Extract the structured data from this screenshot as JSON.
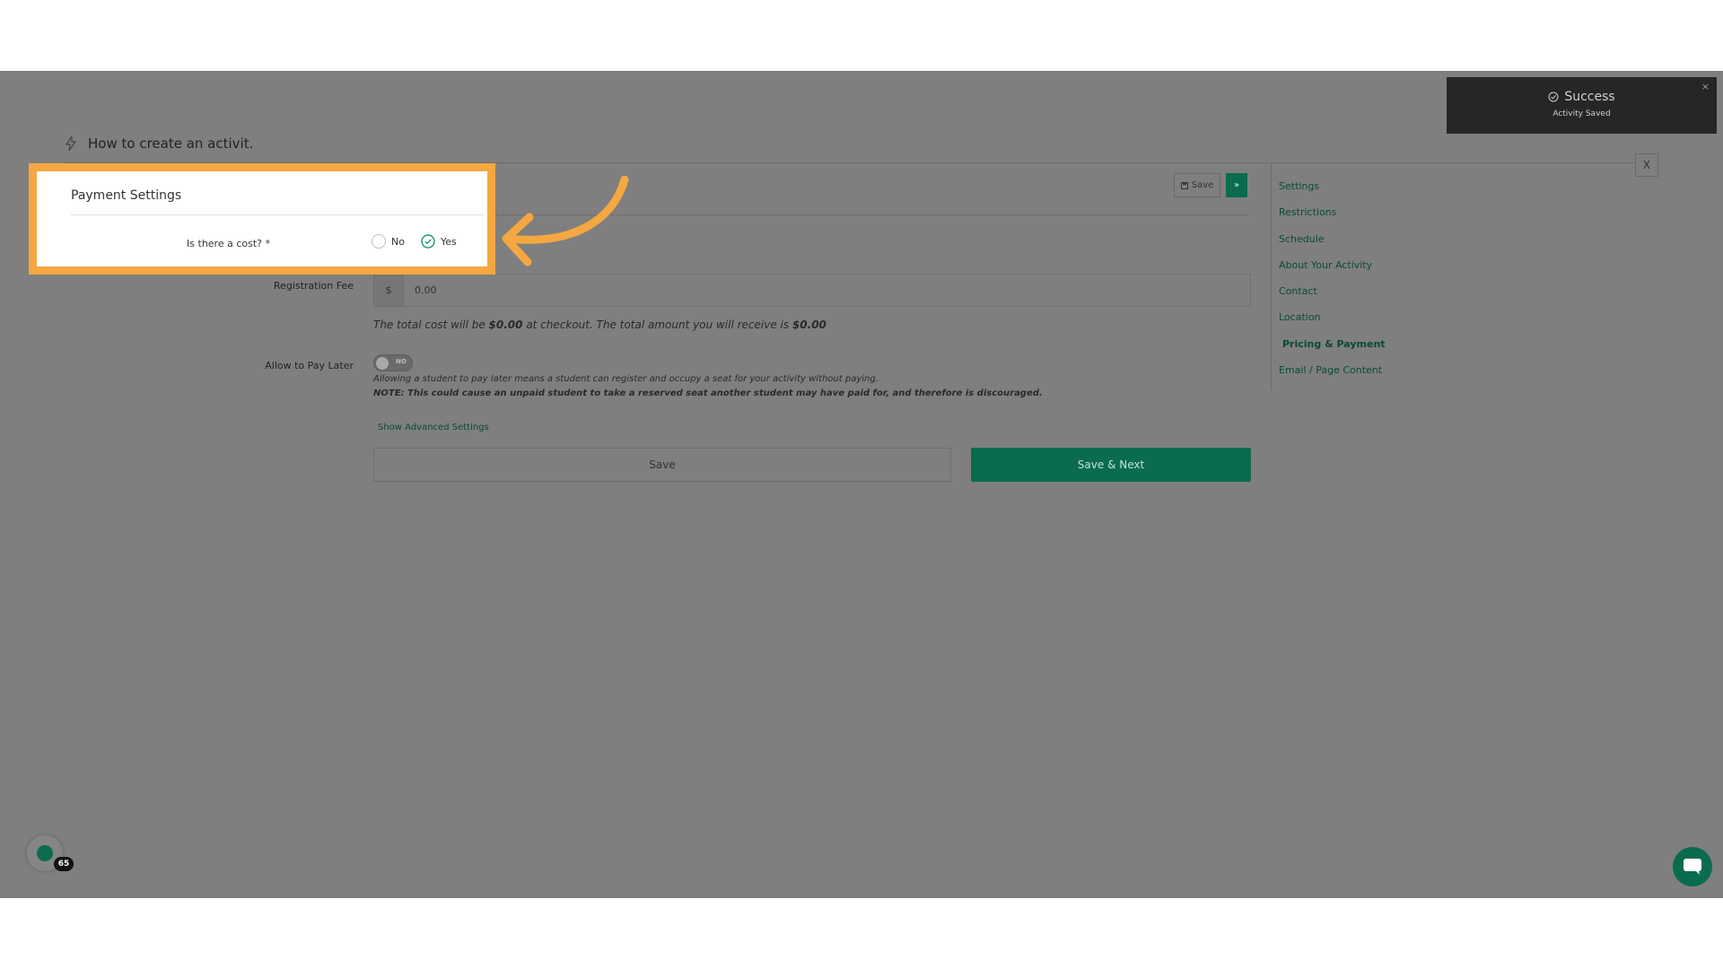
{
  "page": {
    "title": "How to create an activit."
  },
  "toast": {
    "title": "Success",
    "message": "Activity Saved",
    "close": "×"
  },
  "dialog": {
    "close": "X"
  },
  "toolbar": {
    "save_label": "Save",
    "next_label": "»"
  },
  "nav": {
    "items": [
      {
        "label": "Settings"
      },
      {
        "label": "Restrictions"
      },
      {
        "label": "Schedule"
      },
      {
        "label": "About Your Activity"
      },
      {
        "label": "Contact"
      },
      {
        "label": "Location"
      },
      {
        "label": "Pricing & Payment",
        "active": true
      },
      {
        "label": "Email / Page Content"
      }
    ]
  },
  "payment": {
    "heading": "Payment Settings",
    "cost_question": "Is there a cost? *",
    "option_no": "No",
    "option_yes": "Yes",
    "selected": "Yes"
  },
  "fee": {
    "label": "Registration Fee",
    "currency": "$",
    "value": "0.00",
    "note_prefix": "The total cost will be ",
    "note_total": "$0.00",
    "note_middle": " at checkout. The total amount you will receive is ",
    "note_receive": "$0.00"
  },
  "pay_later": {
    "label": "Allow to Pay Later",
    "toggle_text": "NO",
    "description": "Allowing a student to pay later means a student can register and occupy a seat for your activity without paying.",
    "warning": "NOTE: This could cause an unpaid student to take a reserved seat another student may have paid for, and therefore is discouraged."
  },
  "advanced": {
    "link": "Show Advanced Settings"
  },
  "actions": {
    "save": "Save",
    "save_next": "Save & Next"
  },
  "widget": {
    "badge": "65"
  },
  "colors": {
    "accent": "#0b6b4f",
    "highlight": "#f5a742",
    "overlay": "#7f7f7f"
  }
}
